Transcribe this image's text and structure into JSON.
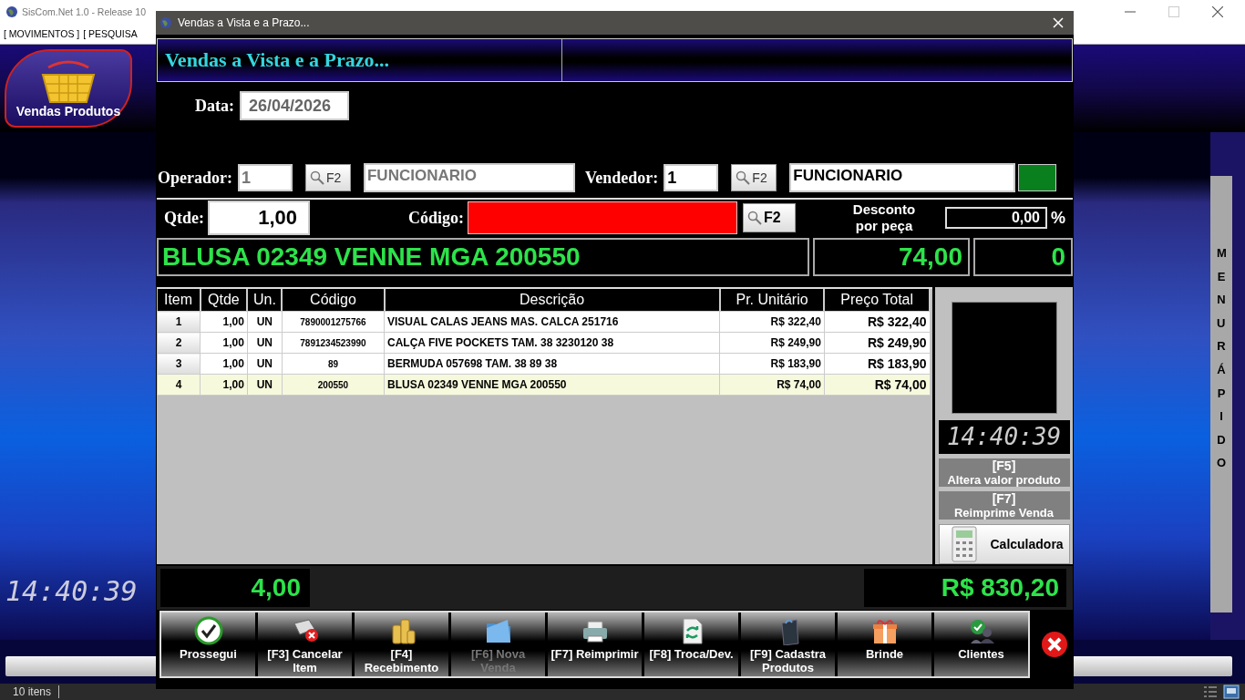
{
  "app": {
    "title": "SisCom.Net 1.0 - Release 10",
    "menu": [
      {
        "label": "[ MOVIMENTOS ]"
      },
      {
        "label": "[ PESQUISA"
      }
    ],
    "toolbar": [
      {
        "label": "Vendas Produtos"
      }
    ],
    "clock": "14:40:39",
    "side_menu": "MENU RÁPIDO",
    "status_bar": "10 itens"
  },
  "dialog": {
    "title": "Vendas a Vista e a Prazo...",
    "heading": "Vendas a Vista e a Prazo...",
    "date": {
      "label": "Data:",
      "value": "26/04/2026"
    },
    "operator": {
      "label": "Operador:",
      "value": "1",
      "lookup": "F2",
      "name": "FUNCIONARIO"
    },
    "seller": {
      "label": "Vendedor:",
      "value": "1",
      "lookup": "F2",
      "name": "FUNCIONARIO"
    },
    "quantity": {
      "label": "Qtde:",
      "value": "1,00"
    },
    "code": {
      "label": "Código:",
      "lookup": "F2"
    },
    "discount": {
      "label": "Desconto por peça",
      "value": "0,00",
      "unit": "%"
    },
    "product": {
      "description": "BLUSA 02349 VENNE MGA 200550",
      "price": "74,00",
      "box_3": "0"
    },
    "table": {
      "columns": [
        "Item",
        "Qtde",
        "Un.",
        "Código",
        "Descrição",
        "Pr. Unitário",
        "Preço Total"
      ],
      "rows": [
        {
          "cells": [
            "1",
            "1,00",
            "UN",
            "7890001275766",
            "VISUAL CALAS JEANS MAS. CALCA 251716",
            "R$ 322,40",
            "R$ 322,40"
          ],
          "selected": false
        },
        {
          "cells": [
            "2",
            "1,00",
            "UN",
            "7891234523990",
            "CALÇA FIVE POCKETS  TAM. 38 3230120 38",
            "R$ 249,90",
            "R$ 249,90"
          ],
          "selected": false
        },
        {
          "cells": [
            "3",
            "1,00",
            "UN",
            "89",
            "BERMUDA 057698  TAM. 38 89 38",
            "R$ 183,90",
            "R$ 183,90"
          ],
          "selected": false
        },
        {
          "cells": [
            "4",
            "1,00",
            "UN",
            "200550",
            "BLUSA 02349 VENNE MGA 200550",
            "R$ 74,00",
            "R$ 74,00"
          ],
          "selected": true
        }
      ]
    },
    "side": {
      "clock": "14:40:39",
      "buttons": [
        {
          "key": "[F5]",
          "label": "Altera valor produto"
        },
        {
          "key": "[F7]",
          "label": "Reimprime Venda"
        }
      ],
      "calculator": "Calculadora"
    },
    "totals": {
      "quantity": "4,00",
      "amount": "R$ 830,20"
    },
    "actions": [
      {
        "kind": "check",
        "label": "Prossegui",
        "disabled": false
      },
      {
        "kind": "cancel",
        "label": "[F3] Cancelar Item",
        "disabled": false
      },
      {
        "kind": "coins",
        "label": "[F4] Recebimento",
        "disabled": false
      },
      {
        "kind": "folder",
        "label": "[F6] Nova Venda",
        "disabled": true
      },
      {
        "kind": "printer",
        "label": "[F7] Reimprimir",
        "disabled": false
      },
      {
        "kind": "exchange",
        "label": "[F8] Troca/Dev.",
        "disabled": false
      },
      {
        "kind": "bag",
        "label": "[F9] Cadastra Produtos",
        "disabled": false
      },
      {
        "kind": "gift",
        "label": "Brinde",
        "disabled": false
      },
      {
        "kind": "clients",
        "label": "Clientes",
        "disabled": false
      }
    ]
  }
}
